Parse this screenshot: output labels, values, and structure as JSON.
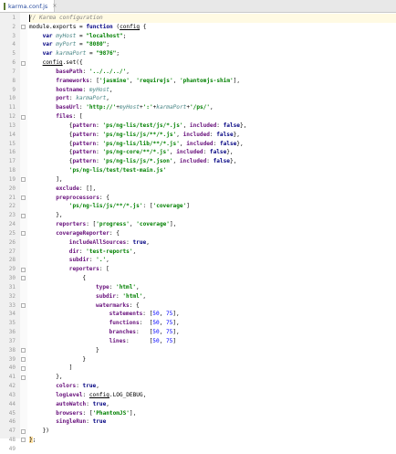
{
  "tab": {
    "title": "karma.conf.js",
    "close": "×"
  },
  "code": [
    {
      "n": "1",
      "indent": 0,
      "tokens": [
        [
          "cm",
          "// Karma configuration"
        ]
      ]
    },
    {
      "n": "2",
      "indent": 0,
      "tokens": [
        [
          "",
          "module.exports = "
        ],
        [
          "kw",
          "function"
        ],
        [
          "",
          " ("
        ],
        [
          "ul",
          "config"
        ],
        [
          "",
          " {"
        ]
      ]
    },
    {
      "n": "3",
      "indent": 1,
      "tokens": [
        [
          "kw",
          "var "
        ],
        [
          "id",
          "myHost"
        ],
        [
          "",
          " = "
        ],
        [
          "str",
          "\"localhost\""
        ],
        [
          "",
          ";"
        ]
      ]
    },
    {
      "n": "4",
      "indent": 1,
      "tokens": [
        [
          "kw",
          "var "
        ],
        [
          "id",
          "myPort"
        ],
        [
          "",
          " = "
        ],
        [
          "str",
          "\"8080\""
        ],
        [
          "",
          ";"
        ]
      ]
    },
    {
      "n": "5",
      "indent": 1,
      "tokens": [
        [
          "kw",
          "var "
        ],
        [
          "id",
          "karmaPort"
        ],
        [
          "",
          " = "
        ],
        [
          "str",
          "\"9876\""
        ],
        [
          "",
          ";"
        ]
      ]
    },
    {
      "n": "6",
      "indent": 1,
      "tokens": [
        [
          "ul",
          "config"
        ],
        [
          "",
          ".set({"
        ]
      ]
    },
    {
      "n": "7",
      "indent": 2,
      "tokens": [
        [
          "prop",
          "basePath"
        ],
        [
          "",
          ": "
        ],
        [
          "str",
          "'../../../'"
        ],
        [
          "",
          ","
        ]
      ]
    },
    {
      "n": "8",
      "indent": 2,
      "tokens": [
        [
          "prop",
          "frameworks"
        ],
        [
          "",
          ": ["
        ],
        [
          "str",
          "'jasmine'"
        ],
        [
          "",
          ", "
        ],
        [
          "str",
          "'requirejs'"
        ],
        [
          "",
          ", "
        ],
        [
          "str",
          "'phantomjs-shim'"
        ],
        [
          "",
          "],"
        ]
      ]
    },
    {
      "n": "9",
      "indent": 2,
      "tokens": [
        [
          "prop",
          "hostname"
        ],
        [
          "",
          ": "
        ],
        [
          "id",
          "myHost"
        ],
        [
          "",
          ","
        ]
      ]
    },
    {
      "n": "10",
      "indent": 2,
      "tokens": [
        [
          "prop",
          "port"
        ],
        [
          "",
          ": "
        ],
        [
          "id",
          "karmaPort"
        ],
        [
          "",
          ","
        ]
      ]
    },
    {
      "n": "11",
      "indent": 2,
      "tokens": [
        [
          "prop",
          "baseUrl"
        ],
        [
          "",
          ": "
        ],
        [
          "str",
          "'http://'"
        ],
        [
          "",
          "+"
        ],
        [
          "id",
          "myHost"
        ],
        [
          "",
          "+"
        ],
        [
          "str",
          "':'"
        ],
        [
          "",
          "+"
        ],
        [
          "id",
          "karmaPort"
        ],
        [
          "",
          "+"
        ],
        [
          "str",
          "'/ps/'"
        ],
        [
          "",
          ","
        ]
      ]
    },
    {
      "n": "12",
      "indent": 2,
      "tokens": [
        [
          "prop",
          "files"
        ],
        [
          "",
          ": ["
        ]
      ]
    },
    {
      "n": "13",
      "indent": 3,
      "tokens": [
        [
          "",
          "{"
        ],
        [
          "prop",
          "pattern"
        ],
        [
          "",
          ": "
        ],
        [
          "str",
          "'ps/ng-lis/test/js/*.js'"
        ],
        [
          "",
          ", "
        ],
        [
          "prop",
          "included"
        ],
        [
          "",
          ": "
        ],
        [
          "kw",
          "false"
        ],
        [
          "",
          "},"
        ]
      ]
    },
    {
      "n": "14",
      "indent": 3,
      "tokens": [
        [
          "",
          "{"
        ],
        [
          "prop",
          "pattern"
        ],
        [
          "",
          ": "
        ],
        [
          "str",
          "'ps/ng-lis/js/**/*.js'"
        ],
        [
          "",
          ", "
        ],
        [
          "prop",
          "included"
        ],
        [
          "",
          ": "
        ],
        [
          "kw",
          "false"
        ],
        [
          "",
          "},"
        ]
      ]
    },
    {
      "n": "15",
      "indent": 3,
      "tokens": [
        [
          "",
          "{"
        ],
        [
          "prop",
          "pattern"
        ],
        [
          "",
          ": "
        ],
        [
          "str",
          "'ps/ng-lis/lib/**/*.js'"
        ],
        [
          "",
          ", "
        ],
        [
          "prop",
          "included"
        ],
        [
          "",
          ": "
        ],
        [
          "kw",
          "false"
        ],
        [
          "",
          "},"
        ]
      ]
    },
    {
      "n": "16",
      "indent": 3,
      "tokens": [
        [
          "",
          "{"
        ],
        [
          "prop",
          "pattern"
        ],
        [
          "",
          ": "
        ],
        [
          "str",
          "'ps/ng-core/**/*.js'"
        ],
        [
          "",
          ", "
        ],
        [
          "prop",
          "included"
        ],
        [
          "",
          ": "
        ],
        [
          "kw",
          "false"
        ],
        [
          "",
          "},"
        ]
      ]
    },
    {
      "n": "17",
      "indent": 3,
      "tokens": [
        [
          "",
          "{"
        ],
        [
          "prop",
          "pattern"
        ],
        [
          "",
          ": "
        ],
        [
          "str",
          "'ps/ng-lis/js/*.json'"
        ],
        [
          "",
          ", "
        ],
        [
          "prop",
          "included"
        ],
        [
          "",
          ": "
        ],
        [
          "kw",
          "false"
        ],
        [
          "",
          "},"
        ]
      ]
    },
    {
      "n": "18",
      "indent": 3,
      "tokens": [
        [
          "str",
          "'ps/ng-lis/test/test-main.js'"
        ]
      ]
    },
    {
      "n": "19",
      "indent": 2,
      "tokens": [
        [
          "",
          "],"
        ]
      ]
    },
    {
      "n": "20",
      "indent": 2,
      "tokens": [
        [
          "prop",
          "exclude"
        ],
        [
          "",
          ": [],"
        ]
      ]
    },
    {
      "n": "21",
      "indent": 2,
      "tokens": [
        [
          "prop",
          "preprocessors"
        ],
        [
          "",
          ": {"
        ]
      ]
    },
    {
      "n": "22",
      "indent": 3,
      "tokens": [
        [
          "str",
          "'ps/ng-lis/js/**/*.js'"
        ],
        [
          "",
          ": ["
        ],
        [
          "str",
          "'coverage'"
        ],
        [
          "",
          "]"
        ]
      ]
    },
    {
      "n": "23",
      "indent": 2,
      "tokens": [
        [
          "",
          "},"
        ]
      ]
    },
    {
      "n": "24",
      "indent": 2,
      "tokens": [
        [
          "prop",
          "reporters"
        ],
        [
          "",
          ": ["
        ],
        [
          "str",
          "'progress'"
        ],
        [
          "",
          ", "
        ],
        [
          "str",
          "'coverage'"
        ],
        [
          "",
          "],"
        ]
      ]
    },
    {
      "n": "25",
      "indent": 2,
      "tokens": [
        [
          "prop",
          "coverageReporter"
        ],
        [
          "",
          ": {"
        ]
      ]
    },
    {
      "n": "26",
      "indent": 3,
      "tokens": [
        [
          "prop",
          "includeAllSources"
        ],
        [
          "",
          ": "
        ],
        [
          "kw",
          "true"
        ],
        [
          "",
          ","
        ]
      ]
    },
    {
      "n": "27",
      "indent": 3,
      "tokens": [
        [
          "prop",
          "dir"
        ],
        [
          "",
          ": "
        ],
        [
          "str",
          "'test-reports'"
        ],
        [
          "",
          ","
        ]
      ]
    },
    {
      "n": "28",
      "indent": 3,
      "tokens": [
        [
          "prop",
          "subdir"
        ],
        [
          "",
          ": "
        ],
        [
          "str",
          "'.'"
        ],
        [
          "",
          ","
        ]
      ]
    },
    {
      "n": "29",
      "indent": 3,
      "tokens": [
        [
          "prop",
          "reporters"
        ],
        [
          "",
          ": ["
        ]
      ]
    },
    {
      "n": "30",
      "indent": 4,
      "tokens": [
        [
          "",
          "{"
        ]
      ]
    },
    {
      "n": "31",
      "indent": 5,
      "tokens": [
        [
          "prop",
          "type"
        ],
        [
          "",
          ": "
        ],
        [
          "str",
          "'html'"
        ],
        [
          "",
          ","
        ]
      ]
    },
    {
      "n": "32",
      "indent": 5,
      "tokens": [
        [
          "prop",
          "subdir"
        ],
        [
          "",
          ": "
        ],
        [
          "str",
          "'html'"
        ],
        [
          "",
          ","
        ]
      ]
    },
    {
      "n": "33",
      "indent": 5,
      "tokens": [
        [
          "prop",
          "watermarks"
        ],
        [
          "",
          ": {"
        ]
      ]
    },
    {
      "n": "34",
      "indent": 6,
      "tokens": [
        [
          "prop",
          "statements"
        ],
        [
          "",
          ": ["
        ],
        [
          "num",
          "50"
        ],
        [
          "",
          ", "
        ],
        [
          "num",
          "75"
        ],
        [
          "",
          "],"
        ]
      ]
    },
    {
      "n": "35",
      "indent": 6,
      "tokens": [
        [
          "prop",
          "functions"
        ],
        [
          "",
          ":  ["
        ],
        [
          "num",
          "50"
        ],
        [
          "",
          ", "
        ],
        [
          "num",
          "75"
        ],
        [
          "",
          "],"
        ]
      ]
    },
    {
      "n": "36",
      "indent": 6,
      "tokens": [
        [
          "prop",
          "branches"
        ],
        [
          "",
          ":   ["
        ],
        [
          "num",
          "50"
        ],
        [
          "",
          ", "
        ],
        [
          "num",
          "75"
        ],
        [
          "",
          "],"
        ]
      ]
    },
    {
      "n": "37",
      "indent": 6,
      "tokens": [
        [
          "prop",
          "lines"
        ],
        [
          "",
          ":      ["
        ],
        [
          "num",
          "50"
        ],
        [
          "",
          ", "
        ],
        [
          "num",
          "75"
        ],
        [
          "",
          "]"
        ]
      ]
    },
    {
      "n": "38",
      "indent": 5,
      "tokens": [
        [
          "",
          "}"
        ]
      ]
    },
    {
      "n": "39",
      "indent": 4,
      "tokens": [
        [
          "",
          "}"
        ]
      ]
    },
    {
      "n": "40",
      "indent": 3,
      "tokens": [
        [
          "",
          "]"
        ]
      ]
    },
    {
      "n": "41",
      "indent": 2,
      "tokens": [
        [
          "",
          "},"
        ]
      ]
    },
    {
      "n": "42",
      "indent": 2,
      "tokens": [
        [
          "prop",
          "colors"
        ],
        [
          "",
          ": "
        ],
        [
          "kw",
          "true"
        ],
        [
          "",
          ","
        ]
      ]
    },
    {
      "n": "43",
      "indent": 2,
      "tokens": [
        [
          "prop",
          "logLevel"
        ],
        [
          "",
          ": "
        ],
        [
          "ul",
          "config"
        ],
        [
          "",
          ".LOG_DEBUG,"
        ]
      ]
    },
    {
      "n": "44",
      "indent": 2,
      "tokens": [
        [
          "prop",
          "autoWatch"
        ],
        [
          "",
          ": "
        ],
        [
          "kw",
          "true"
        ],
        [
          "",
          ","
        ]
      ]
    },
    {
      "n": "45",
      "indent": 2,
      "tokens": [
        [
          "prop",
          "browsers"
        ],
        [
          "",
          ": ["
        ],
        [
          "str",
          "'PhantomJS'"
        ],
        [
          "",
          "],"
        ]
      ]
    },
    {
      "n": "46",
      "indent": 2,
      "tokens": [
        [
          "prop",
          "singleRun"
        ],
        [
          "",
          ": "
        ],
        [
          "kw",
          "true"
        ]
      ]
    },
    {
      "n": "47",
      "indent": 1,
      "tokens": [
        [
          "",
          "})"
        ]
      ]
    },
    {
      "n": "48",
      "indent": 0,
      "tokens": [
        [
          "hl",
          "}"
        ],
        [
          "",
          ";"
        ]
      ]
    },
    {
      "n": "49",
      "indent": 0,
      "tokens": []
    }
  ],
  "current_line": "1"
}
